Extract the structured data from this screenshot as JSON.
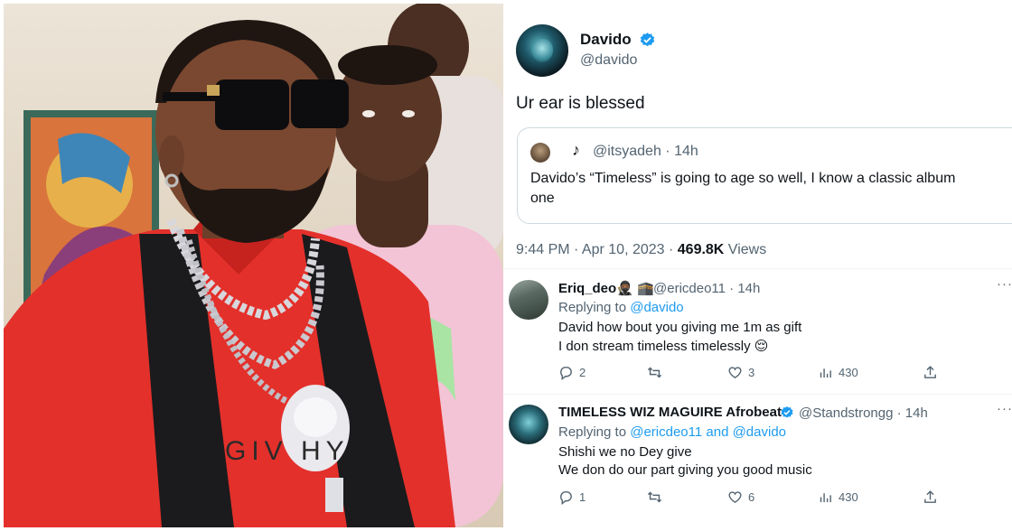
{
  "photo": {
    "shirt_text": "GIV    HY"
  },
  "tweet": {
    "author_name": "Davido",
    "author_handle": "@davido",
    "text": "Ur ear is blessed",
    "quote": {
      "tiktok_glyph": "♪",
      "handle": "@itsyadeh",
      "separator": "·",
      "time": "14h",
      "text_line1": "Davido’s “Timeless” is going to age so well, I know a classic album",
      "text_line2": "one"
    },
    "time": "9:44 PM · Apr 10, 2023 · ",
    "views_count": "469.8K",
    "views_label": " Views"
  },
  "replies": [
    {
      "name": "Eriq_deo",
      "name_emoji": "🥷🏾 🕋",
      "handle_time": "@ericdeo11 · 14h",
      "replying_prefix": "Replying to ",
      "replying_to": "@davido",
      "line1": "David how bout you giving me 1m as gift",
      "line2": "I don stream timeless timelessly 😌",
      "reply_count": "2",
      "retweet_count": "",
      "like_count": "3",
      "view_count": "430",
      "more": "···"
    },
    {
      "name": "TIMELESS WIZ MAGUIRE Afrobeat",
      "handle_time": "@Standstrongg · 14h",
      "replying_prefix": "Replying to ",
      "replying_to": "@ericdeo11 and @davido",
      "line1": "Shishi we no Dey give",
      "line2": "We don do our part giving you good music",
      "reply_count": "1",
      "retweet_count": "",
      "like_count": "6",
      "view_count": "430",
      "more": "···"
    }
  ],
  "colors": {
    "link": "#1d9bf0",
    "verified": "#1d9bf0",
    "text": "#0f1419",
    "muted": "#536471",
    "shirt_red": "#e4302b"
  },
  "icons": [
    "verified-badge-icon",
    "tiktok-icon",
    "reply-icon",
    "retweet-icon",
    "like-icon",
    "views-icon",
    "share-icon",
    "more-icon"
  ]
}
